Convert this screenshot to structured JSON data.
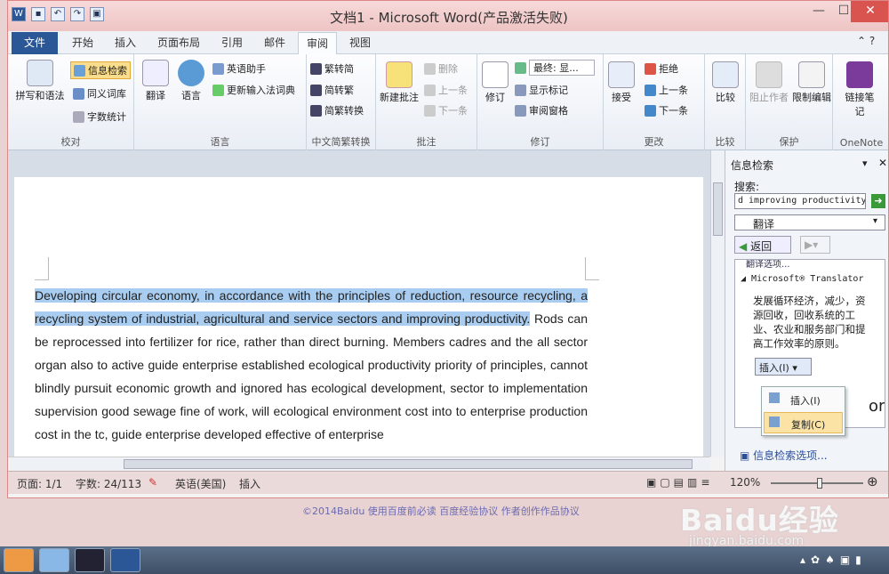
{
  "window": {
    "title": "文档1 - Microsoft Word(产品激活失败)"
  },
  "qat": [
    "W",
    "▪",
    "↶",
    "↷",
    "▣"
  ],
  "tabs": {
    "file": "文件",
    "items": [
      "开始",
      "插入",
      "页面布局",
      "引用",
      "邮件",
      "审阅",
      "视图"
    ],
    "active": "审阅"
  },
  "ribbon": {
    "proofing": {
      "label": "校对",
      "spell": "拼写和语法",
      "research": "信息检索",
      "thesaurus": "同义词库",
      "wordcount": "字数统计"
    },
    "language": {
      "label": "语言",
      "translate": "翻译",
      "language": "语言",
      "english_assistant": "英语助手",
      "update_ime": "更新输入法词典"
    },
    "chinese": {
      "label": "中文简繁转换",
      "t2s": "繁转简",
      "s2t": "简转繁",
      "convert": "简繁转换"
    },
    "comments": {
      "label": "批注",
      "new": "新建批注",
      "delete": "删除",
      "prev": "上一条",
      "next": "下一条"
    },
    "tracking": {
      "label": "修订",
      "track": "修订",
      "final": "最终: 显...",
      "markup": "显示标记",
      "pane": "审阅窗格"
    },
    "changes": {
      "label": "更改",
      "accept": "接受",
      "reject": "拒绝",
      "prev": "上一条",
      "next": "下一条"
    },
    "compare": {
      "label": "比较",
      "compare": "比较"
    },
    "protect": {
      "label": "保护",
      "block": "阻止作者",
      "restrict": "限制编辑"
    },
    "onenote": {
      "label": "OneNote",
      "link": "链接笔记"
    }
  },
  "document": {
    "highlighted": "Developing circular economy, in accordance with the principles of reduction, resource recycling, a recycling system of industrial, agricultural and service sectors and improving productivity.",
    "rest": " Rods can be reprocessed into fertilizer for rice, rather than direct burning. Members cadres and the all sector organ also to active guide enterprise established ecological productivity priority of principles, cannot blindly pursuit economic growth and ignored has ecological development, sector to implementation supervision good sewage fine of work, will ecological environment cost into to enterprise production cost in the tc, guide enterprise developed effective of enterprise"
  },
  "pane": {
    "title": "信息检索",
    "search_label": "搜索:",
    "search_value": "d improving productivity.",
    "service": "翻译",
    "back": "返回",
    "partial": "翻译选项...",
    "provider": "Microsoft® Translator",
    "result": "发展循环经济，减少，资源回收，回收系统的工业、农业和服务部门和提高工作效率的原则。",
    "insert": "插入(I)",
    "menu_insert": "插入(I)",
    "menu_copy": "复制(C)",
    "partial2": "or",
    "options": "信息检索选项..."
  },
  "status": {
    "page": "页面: 1/1",
    "words": "字数: 24/113",
    "lang": "英语(美国)",
    "mode": "插入",
    "zoom": "120%"
  },
  "footer": "©2014Baidu  使用百度前必读  百度经验协议  作者创作作品协议",
  "watermark": {
    "brand": "Baidu经验",
    "url": "jingyan.baidu.com"
  },
  "colors": {
    "accent": "#2b5797",
    "highlight": "#a9cdf0",
    "titlebar": "#eec4c4"
  }
}
